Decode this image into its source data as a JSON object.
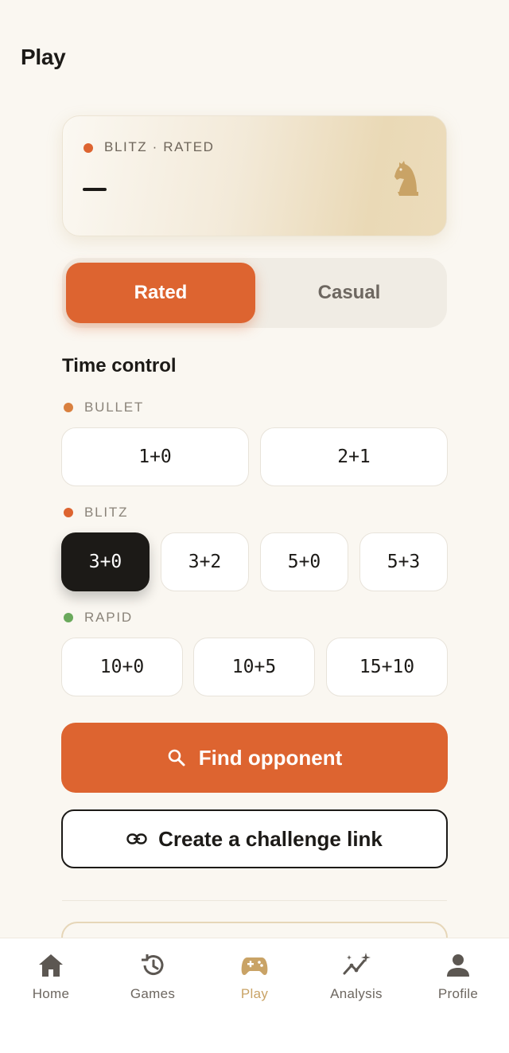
{
  "header": {
    "title": "Play"
  },
  "hero": {
    "mode_label": "BLITZ · RATED",
    "value": "—",
    "accent": "#dd6430"
  },
  "mode_toggle": {
    "options": [
      "Rated",
      "Casual"
    ],
    "selected": "Rated"
  },
  "time_control": {
    "title": "Time control",
    "categories": [
      {
        "label": "BULLET",
        "color": "#d9803f",
        "options": [
          "1+0",
          "2+1"
        ]
      },
      {
        "label": "BLITZ",
        "color": "#dd6430",
        "options": [
          "3+0",
          "3+2",
          "5+0",
          "5+3"
        ]
      },
      {
        "label": "RAPID",
        "color": "#6aa95c",
        "options": [
          "10+0",
          "10+5",
          "15+10"
        ]
      }
    ],
    "selected": "3+0"
  },
  "actions": {
    "find_label": "Find opponent",
    "challenge_label": "Create a challenge link"
  },
  "bottom_nav": {
    "items": [
      {
        "label": "Home",
        "icon": "home-icon"
      },
      {
        "label": "Games",
        "icon": "history-icon"
      },
      {
        "label": "Play",
        "icon": "gamepad-icon",
        "active": true
      },
      {
        "label": "Analysis",
        "icon": "analysis-icon"
      },
      {
        "label": "Profile",
        "icon": "person-icon"
      }
    ]
  },
  "colors": {
    "brand": "#dd6430",
    "background": "#faf7f1",
    "active_nav": "#c9a366",
    "dark": "#1c1a17"
  }
}
